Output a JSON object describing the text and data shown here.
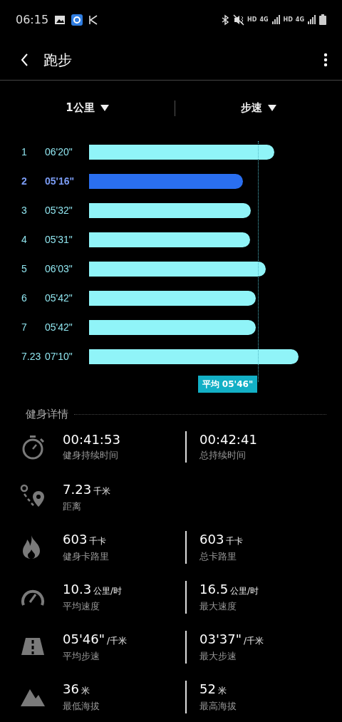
{
  "status_bar": {
    "time": "06:15",
    "indicators": [
      "HD",
      "4G",
      "HD",
      "4G"
    ]
  },
  "app_bar": {
    "title": "跑步"
  },
  "filters": [
    {
      "label": "1公里"
    },
    {
      "label": "步速"
    }
  ],
  "splits": {
    "rows": [
      {
        "split": "1",
        "pace": "06'20\"",
        "selected": false
      },
      {
        "split": "2",
        "pace": "05'16\"",
        "selected": true
      },
      {
        "split": "3",
        "pace": "05'32\"",
        "selected": false
      },
      {
        "split": "4",
        "pace": "05'31\"",
        "selected": false
      },
      {
        "split": "5",
        "pace": "06'03\"",
        "selected": false
      },
      {
        "split": "6",
        "pace": "05'42\"",
        "selected": false
      },
      {
        "split": "7",
        "pace": "05'42\"",
        "selected": false
      },
      {
        "split": "7.23",
        "pace": "07'10\"",
        "selected": false
      }
    ],
    "average": {
      "label": "平均 05'46\""
    }
  },
  "details": {
    "title": "健身详情",
    "rows": [
      {
        "kind": "stopwatch",
        "items": [
          {
            "value": "00:41:53",
            "label": "健身持续时间"
          },
          {
            "value": "00:42:41",
            "label": "总持续时间"
          }
        ]
      },
      {
        "kind": "route",
        "items": [
          {
            "value": "7.23",
            "unit": "千米",
            "label": "距离"
          }
        ]
      },
      {
        "kind": "flame",
        "items": [
          {
            "value": "603",
            "unit": "千卡",
            "label": "健身卡路里"
          },
          {
            "value": "603",
            "unit": "千卡",
            "label": "总卡路里"
          }
        ]
      },
      {
        "kind": "gauge",
        "items": [
          {
            "value": "10.3",
            "unit": "公里/时",
            "label": "平均速度"
          },
          {
            "value": "16.5",
            "unit": "公里/时",
            "label": "最大速度"
          }
        ]
      },
      {
        "kind": "road",
        "items": [
          {
            "value": "05'46\"",
            "unit": "/千米",
            "label": "平均步速"
          },
          {
            "value": "03'37\"",
            "unit": "/千米",
            "label": "最大步速"
          }
        ]
      },
      {
        "kind": "mountain",
        "items": [
          {
            "value": "36",
            "unit": "米",
            "label": "最低海拔"
          },
          {
            "value": "52",
            "unit": "米",
            "label": "最高海拔"
          }
        ]
      }
    ]
  }
}
